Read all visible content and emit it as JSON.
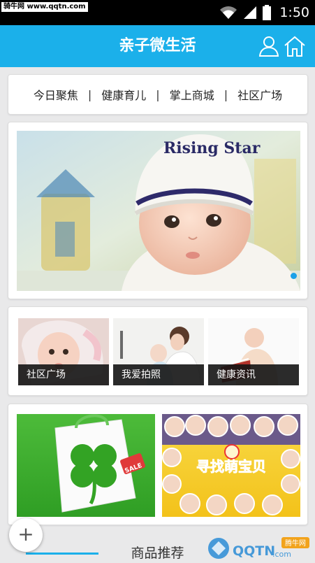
{
  "watermark": "骑牛网 www.qqtn.com",
  "status": {
    "time": "1:50"
  },
  "header": {
    "title": "亲子微生活"
  },
  "nav": {
    "items": [
      "今日聚焦",
      "健康育儿",
      "掌上商城",
      "社区广场"
    ],
    "separator": "|"
  },
  "banner": {
    "hat_text": "Rising Star"
  },
  "categories": [
    "社区广场",
    "我爱拍照",
    "健康资讯"
  ],
  "promo": {
    "sale_tag": "SALE",
    "poster_title": "寻找萌宝贝"
  },
  "bottom": {
    "section_title": "商品推荐",
    "fab_symbol": "+",
    "logo_text": "QQTN",
    "logo_sub": "腾牛网",
    "logo_domain": ".com"
  },
  "colors": {
    "accent": "#1bb0ea",
    "tile_label_bg": "#141414",
    "clover_green": "#3aaa2a"
  }
}
